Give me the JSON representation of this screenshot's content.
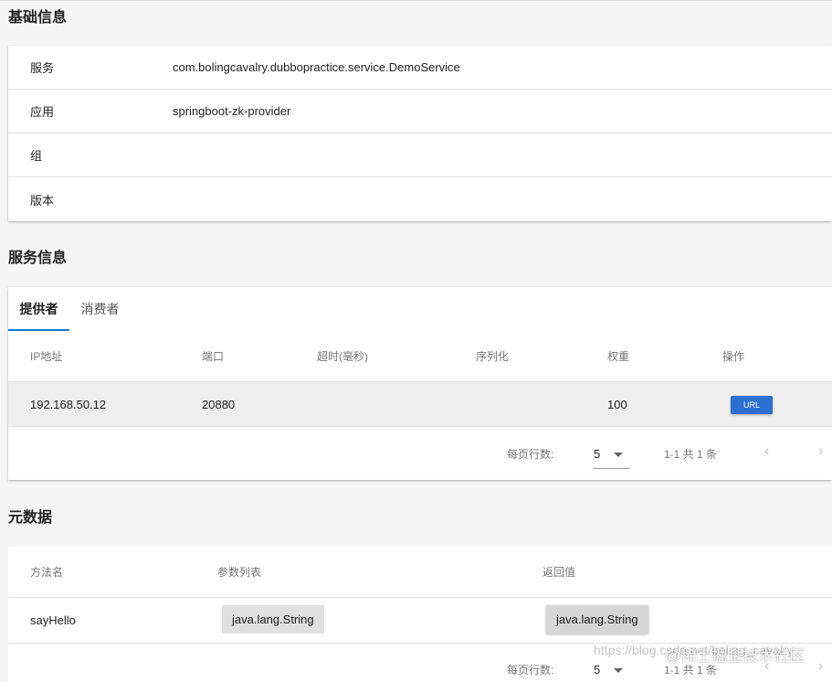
{
  "sections": {
    "basic": "基础信息",
    "service": "服务信息",
    "meta": "元数据"
  },
  "basic_info": [
    {
      "key": "服务",
      "value": "com.bolingcavalry.dubbopractice.service.DemoService"
    },
    {
      "key": "应用",
      "value": "springboot-zk-provider"
    },
    {
      "key": "组",
      "value": ""
    },
    {
      "key": "版本",
      "value": ""
    }
  ],
  "tabs": [
    "提供者",
    "消费者"
  ],
  "provider_table": {
    "columns": [
      "IP地址",
      "端口",
      "超时(毫秒)",
      "序列化",
      "权重",
      "操作"
    ],
    "rows": [
      {
        "ip": "192.168.50.12",
        "port": "20880",
        "timeout": "",
        "serialization": "",
        "weight": "100",
        "action": "URL"
      }
    ]
  },
  "pagination": {
    "rows_per_page_label": "每页行数:",
    "rows_per_page": "5",
    "range": "1-1 共 1 条"
  },
  "meta_table": {
    "columns": [
      "方法名",
      "参数列表",
      "返回值"
    ],
    "rows": [
      {
        "method": "sayHello",
        "params": "java.lang.String",
        "returns": "java.lang.String"
      }
    ]
  },
  "watermark": {
    "url": "https://blog.csdn.net/boling_cavalry",
    "brand": "@稀土掘金技术社区"
  }
}
